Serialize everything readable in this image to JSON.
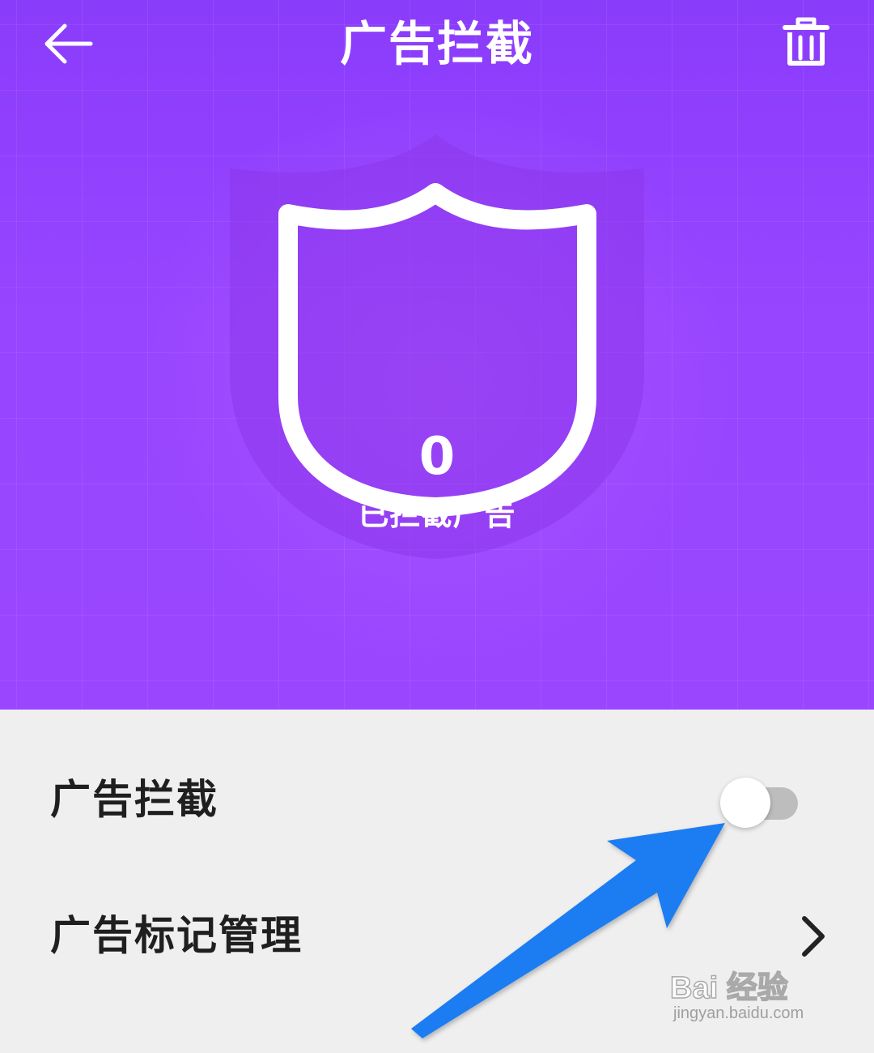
{
  "header": {
    "title": "广告拦截",
    "back_icon": "arrow-left-icon",
    "delete_icon": "trash-icon"
  },
  "shield": {
    "count": "0",
    "caption": "已拦截广告"
  },
  "settings": {
    "ad_block": {
      "label": "广告拦截",
      "enabled": false
    },
    "ad_mark_management": {
      "label": "广告标记管理",
      "icon": "chevron-right-icon"
    }
  },
  "watermark": {
    "brand": "Bai 经验",
    "url": "jingyan.baidu.com"
  },
  "colors": {
    "hero": "#9544ff",
    "list_background": "#efefef",
    "annotation_arrow": "#1f7bf2",
    "toggle_track_off": "#bdbdbd"
  }
}
